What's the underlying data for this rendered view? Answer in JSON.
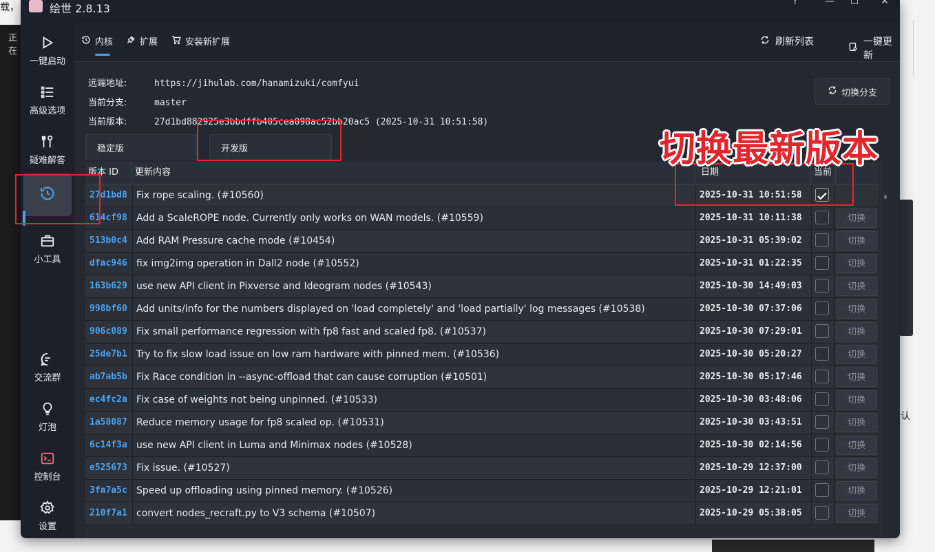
{
  "background": {
    "top_left_text": "载，",
    "left_strip_text": "正在",
    "right_text": "认"
  },
  "window": {
    "title": "绘世 2.8.13",
    "controls": {
      "help": "?",
      "minimize": "—",
      "maximize": "☐",
      "close": "✕"
    }
  },
  "sidebar": {
    "items": [
      {
        "label": "一键启动",
        "icon": "play-icon"
      },
      {
        "label": "高级选项",
        "icon": "list-icon"
      },
      {
        "label": "疑难解答",
        "icon": "tools-icon"
      },
      {
        "label": "",
        "icon": "history-icon",
        "active": true
      },
      {
        "label": "小工具",
        "icon": "toolbox-icon"
      },
      {
        "label": "交流群",
        "icon": "chat-icon"
      },
      {
        "label": "灯泡",
        "icon": "bulb-icon"
      },
      {
        "label": "控制台",
        "icon": "terminal-icon"
      },
      {
        "label": "设置",
        "icon": "gear-icon"
      }
    ]
  },
  "topbar": {
    "tabs": [
      {
        "label": "内核",
        "icon": "history-icon",
        "active": true
      },
      {
        "label": "扩展",
        "icon": "puzzle-icon"
      },
      {
        "label": "安装新扩展",
        "icon": "cart-icon"
      }
    ],
    "refresh_label": "刷新列表",
    "update_label": "一键更新"
  },
  "info": {
    "remote_label": "远端地址:",
    "remote_value": "https://jihulab.com/hanamizuki/comfyui",
    "branch_label": "当前分支:",
    "branch_value": "master",
    "version_label": "当前版本:",
    "version_value": "27d1bd882925e3bbdffb405cea098ac52bb20ac5 (2025-10-31 10:51:58)"
  },
  "switch_branch_label": "切换分支",
  "subtabs": [
    "稳定版",
    "开发版"
  ],
  "annotation_text": "切换最新版本",
  "table": {
    "headers": {
      "id": "版本 ID",
      "msg": "更新内容",
      "date": "日期",
      "current": "当前"
    },
    "switch_label": "切换",
    "rows": [
      {
        "id": "27d1bd8",
        "msg": "Fix rope scaling. (#10560)",
        "date": "2025-10-31 10:51:58",
        "current": true
      },
      {
        "id": "614cf98",
        "msg": "Add a ScaleROPE node. Currently only works on WAN models. (#10559)",
        "date": "2025-10-31 10:11:38",
        "current": false
      },
      {
        "id": "513b0c4",
        "msg": "Add RAM Pressure cache mode (#10454)",
        "date": "2025-10-31 05:39:02",
        "current": false
      },
      {
        "id": "dfac946",
        "msg": "fix img2img operation in Dall2 node (#10552)",
        "date": "2025-10-31 01:22:35",
        "current": false
      },
      {
        "id": "163b629",
        "msg": "use new API client in Pixverse and Ideogram nodes (#10543)",
        "date": "2025-10-30 14:49:03",
        "current": false
      },
      {
        "id": "998bf60",
        "msg": "Add units/info for the numbers displayed on 'load completely' and 'load partially' log messages (#10538)",
        "date": "2025-10-30 07:37:06",
        "current": false
      },
      {
        "id": "906c089",
        "msg": "Fix small performance regression with fp8 fast and scaled fp8. (#10537)",
        "date": "2025-10-30 07:29:01",
        "current": false
      },
      {
        "id": "25de7b1",
        "msg": "Try to fix slow load issue on low ram hardware with pinned mem. (#10536)",
        "date": "2025-10-30 05:20:27",
        "current": false
      },
      {
        "id": "ab7ab5b",
        "msg": "Fix Race condition in --async-offload that can cause corruption (#10501)",
        "date": "2025-10-30 05:17:46",
        "current": false
      },
      {
        "id": "ec4fc2a",
        "msg": "Fix case of weights not being unpinned. (#10533)",
        "date": "2025-10-30 03:48:06",
        "current": false
      },
      {
        "id": "1a58087",
        "msg": "Reduce memory usage for fp8 scaled op. (#10531)",
        "date": "2025-10-30 03:43:51",
        "current": false
      },
      {
        "id": "6c14f3a",
        "msg": "use new API client in Luma and Minimax nodes (#10528)",
        "date": "2025-10-30 02:14:56",
        "current": false
      },
      {
        "id": "e525673",
        "msg": "Fix issue. (#10527)",
        "date": "2025-10-29 12:37:00",
        "current": false
      },
      {
        "id": "3fa7a5c",
        "msg": "Speed up offloading using pinned memory. (#10526)",
        "date": "2025-10-29 12:21:01",
        "current": false
      },
      {
        "id": "210f7a1",
        "msg": "convert nodes_recraft.py to V3 schema (#10507)",
        "date": "2025-10-29 05:38:05",
        "current": false
      }
    ]
  }
}
